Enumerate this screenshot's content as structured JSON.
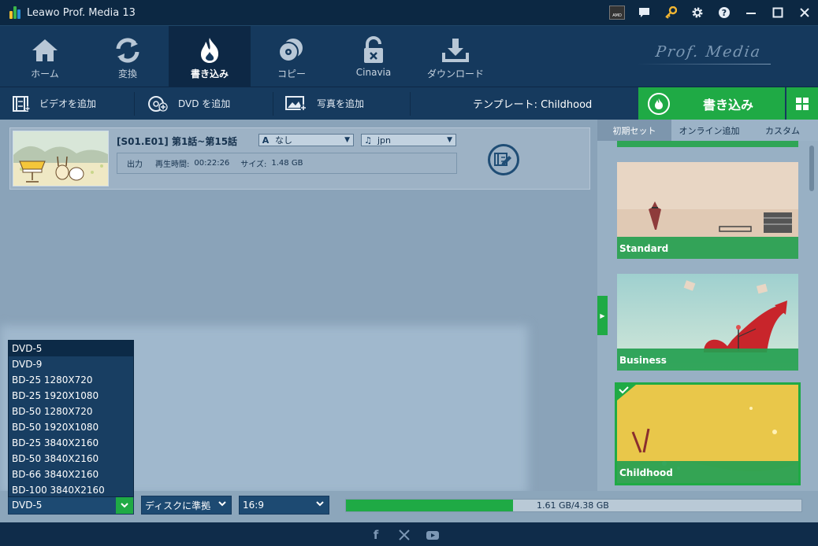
{
  "app": {
    "title": "Leawo Prof. Media 13",
    "brand": "Prof. Media"
  },
  "titlebar_icons": [
    "amd-icon",
    "chat-icon",
    "key-icon",
    "gear-icon",
    "help-icon",
    "minimize-icon",
    "maximize-icon",
    "close-icon"
  ],
  "nav": {
    "items": [
      {
        "label": "ホーム",
        "icon": "home-icon"
      },
      {
        "label": "変換",
        "icon": "convert-icon"
      },
      {
        "label": "書き込み",
        "icon": "burn-icon",
        "active": true
      },
      {
        "label": "コピー",
        "icon": "copy-icon"
      },
      {
        "label": "Cinavia",
        "icon": "cinavia-icon"
      },
      {
        "label": "ダウンロード",
        "icon": "download-icon"
      }
    ]
  },
  "toolbar": {
    "add_video": "ビデオを追加",
    "add_dvd": "DVD を追加",
    "add_photo": "写真を追加",
    "template": "テンプレート: Childhood",
    "burn": "書き込み"
  },
  "file": {
    "title": "[S01.E01] 第1話~第15話",
    "subtitle": "なし",
    "audio": "jpn",
    "output_label": "出力",
    "duration_label": "再生時間:",
    "duration": "00:22:26",
    "size_label": "サイズ:",
    "size": "1.48 GB"
  },
  "right_panel": {
    "tabs": [
      "初期セット",
      "オンライン追加",
      "カスタム"
    ],
    "templates": [
      {
        "name": "Standard"
      },
      {
        "name": "Business"
      },
      {
        "name": "Childhood",
        "selected": true
      }
    ]
  },
  "disc_options": [
    "DVD-5",
    "DVD-9",
    "BD-25 1280X720",
    "BD-25 1920X1080",
    "BD-50 1280X720",
    "BD-50 1920X1080",
    "BD-25 3840X2160",
    "BD-50 3840X2160",
    "BD-66 3840X2160",
    "BD-100 3840X2160"
  ],
  "bottom": {
    "disc_type": "DVD-5",
    "quality": "ディスクに準拠",
    "aspect": "16:9",
    "capacity_text": "1.61 GB/4.38 GB",
    "usage_fraction": 0.3676
  },
  "footer": {
    "social": [
      "facebook-icon",
      "x-icon",
      "youtube-icon"
    ]
  },
  "colors": {
    "accent": "#1faa45",
    "navy": "#15395d",
    "dark": "#0c2843"
  }
}
